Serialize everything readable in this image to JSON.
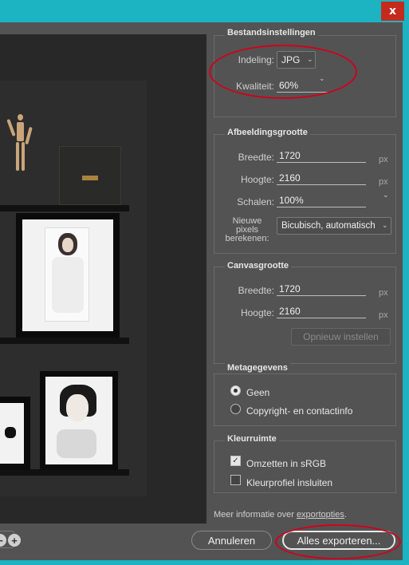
{
  "window": {
    "close_label": "x"
  },
  "file_settings": {
    "title": "Bestandsinstellingen",
    "format_label": "Indeling:",
    "format_value": "JPG",
    "quality_label": "Kwaliteit:",
    "quality_value": "60%"
  },
  "image_size": {
    "title": "Afbeeldingsgrootte",
    "width_label": "Breedte:",
    "width_value": "1720",
    "height_label": "Hoogte:",
    "height_value": "2160",
    "scale_label": "Schalen:",
    "scale_value": "100%",
    "resample_label_1": "Nieuwe",
    "resample_label_2": "pixels",
    "resample_label_3": "berekenen:",
    "resample_value": "Bicubisch, automatisch",
    "unit": "px"
  },
  "canvas_size": {
    "title": "Canvasgrootte",
    "width_label": "Breedte:",
    "width_value": "1720",
    "height_label": "Hoogte:",
    "height_value": "2160",
    "unit": "px",
    "reset_label": "Opnieuw instellen"
  },
  "metadata": {
    "title": "Metagegevens",
    "option_none": "Geen",
    "option_copyright": "Copyright- en contactinfo",
    "selected": "Geen"
  },
  "color_space": {
    "title": "Kleurruimte",
    "convert_label": "Omzetten in sRGB",
    "convert_checked": true,
    "embed_label": "Kleurprofiel insluiten",
    "embed_checked": false
  },
  "footer": {
    "info_prefix": "Meer informatie over ",
    "info_link": "exportopties",
    "info_suffix": ".",
    "cancel_label": "Annuleren",
    "export_label": "Alles exporteren..."
  },
  "icons": {
    "close": "close-icon",
    "zoom_in": "zoom-in-icon",
    "chevron": "chevron-down-icon"
  },
  "colors": {
    "accent_titlebar": "#1cb3c3",
    "close_button": "#c42b1c",
    "panel_bg": "#535353",
    "annotation": "#d0021b"
  }
}
